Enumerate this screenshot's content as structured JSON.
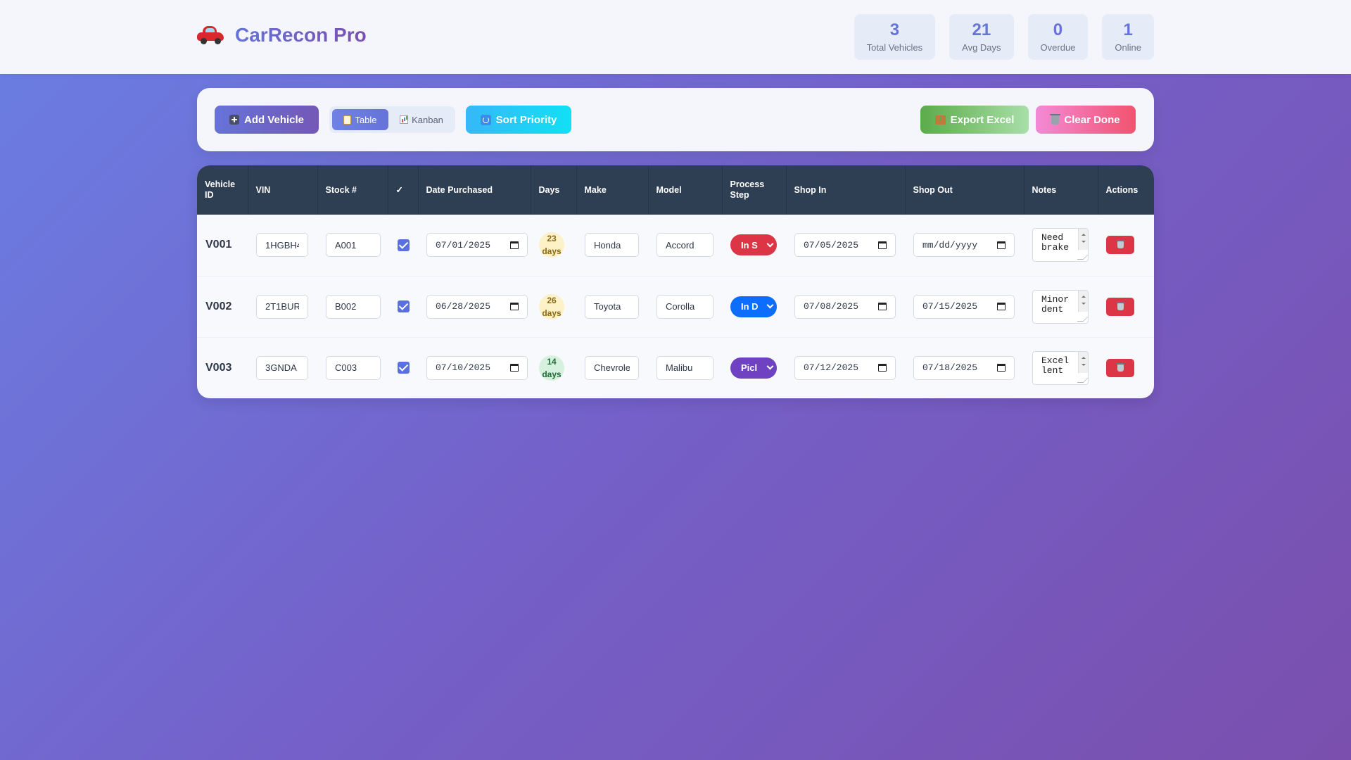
{
  "app": {
    "title": "CarRecon Pro",
    "logo_icon": "car-icon"
  },
  "stats": [
    {
      "value": "3",
      "label": "Total Vehicles"
    },
    {
      "value": "21",
      "label": "Avg Days"
    },
    {
      "value": "0",
      "label": "Overdue"
    },
    {
      "value": "1",
      "label": "Online"
    }
  ],
  "toolbar": {
    "add_label": "Add Vehicle",
    "view_table_label": "Table",
    "view_kanban_label": "Kanban",
    "active_view": "Table",
    "sort_label": "Sort Priority",
    "export_label": "Export Excel",
    "clear_label": "Clear Done"
  },
  "table": {
    "headers": [
      "Vehicle ID",
      "VIN",
      "Stock #",
      "✓",
      "Date Purchased",
      "Days",
      "Make",
      "Model",
      "Process Step",
      "Shop In",
      "Shop Out",
      "Notes",
      "Actions"
    ],
    "rows": [
      {
        "id": "V001",
        "vin": "1HGBH4",
        "stock": "A001",
        "checked": true,
        "date_purchased": "07/01/2025",
        "days_num": "23",
        "days_unit": "days",
        "make": "Honda",
        "model": "Accord",
        "step": "In S",
        "step_color": "#dc3545",
        "shop_in": "07/05/2025",
        "shop_out": "mm/dd/yyyy",
        "notes": "Need brake"
      },
      {
        "id": "V002",
        "vin": "2T1BUR",
        "stock": "B002",
        "checked": true,
        "date_purchased": "06/28/2025",
        "days_num": "26",
        "days_unit": "days",
        "make": "Toyota",
        "model": "Corolla",
        "step": "In D",
        "step_color": "#0d6efd",
        "shop_in": "07/08/2025",
        "shop_out": "07/15/2025",
        "notes": "Minor dent"
      },
      {
        "id": "V003",
        "vin": "3GNDA",
        "stock": "C003",
        "checked": true,
        "date_purchased": "07/10/2025",
        "days_num": "14",
        "days_unit": "days",
        "make": "Chevrole",
        "model": "Malibu",
        "step": "Picl",
        "step_color": "#6f42c1",
        "shop_in": "07/12/2025",
        "shop_out": "07/18/2025",
        "notes": "Excellent"
      }
    ]
  },
  "colors": {
    "accent": "#6673d8",
    "header_bg": "#2e3e53",
    "delete": "#dc3545"
  }
}
